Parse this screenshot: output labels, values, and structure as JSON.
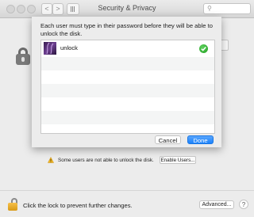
{
  "window": {
    "title": "Security & Privacy",
    "nav_back": "<",
    "nav_forward": ">",
    "search_placeholder": ""
  },
  "sheet": {
    "message": "Each user must type in their password before they will be able to unlock the disk.",
    "users": [
      {
        "name": "unlock",
        "enabled": true
      }
    ],
    "cancel_label": "Cancel",
    "done_label": "Done"
  },
  "warning": {
    "text": "Some users are not able to unlock the disk.",
    "enable_label": "Enable Users..."
  },
  "footer": {
    "lock_text": "Click the lock to prevent further changes.",
    "advanced_label": "Advanced...",
    "help_label": "?"
  },
  "colors": {
    "accent": "#1a82fb",
    "check_green": "#1e9e1e",
    "lock_gold": "#e6a92a"
  }
}
